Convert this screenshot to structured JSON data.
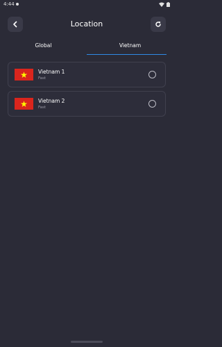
{
  "status_bar": {
    "time": "4:44"
  },
  "header": {
    "title": "Location"
  },
  "tabs": [
    {
      "label": "Global",
      "active": false
    },
    {
      "label": "Vietnam",
      "active": true
    }
  ],
  "servers": [
    {
      "name": "Vietnam 1",
      "speed": "Fast",
      "flag": "vietnam-flag",
      "selected": false
    },
    {
      "name": "Vietnam 2",
      "speed": "Fast",
      "flag": "vietnam-flag",
      "selected": false
    }
  ],
  "colors": {
    "background": "#2b2b37",
    "tab_indicator": "#2f8be6",
    "flag_red": "#da251d",
    "flag_star": "#ffff00"
  }
}
